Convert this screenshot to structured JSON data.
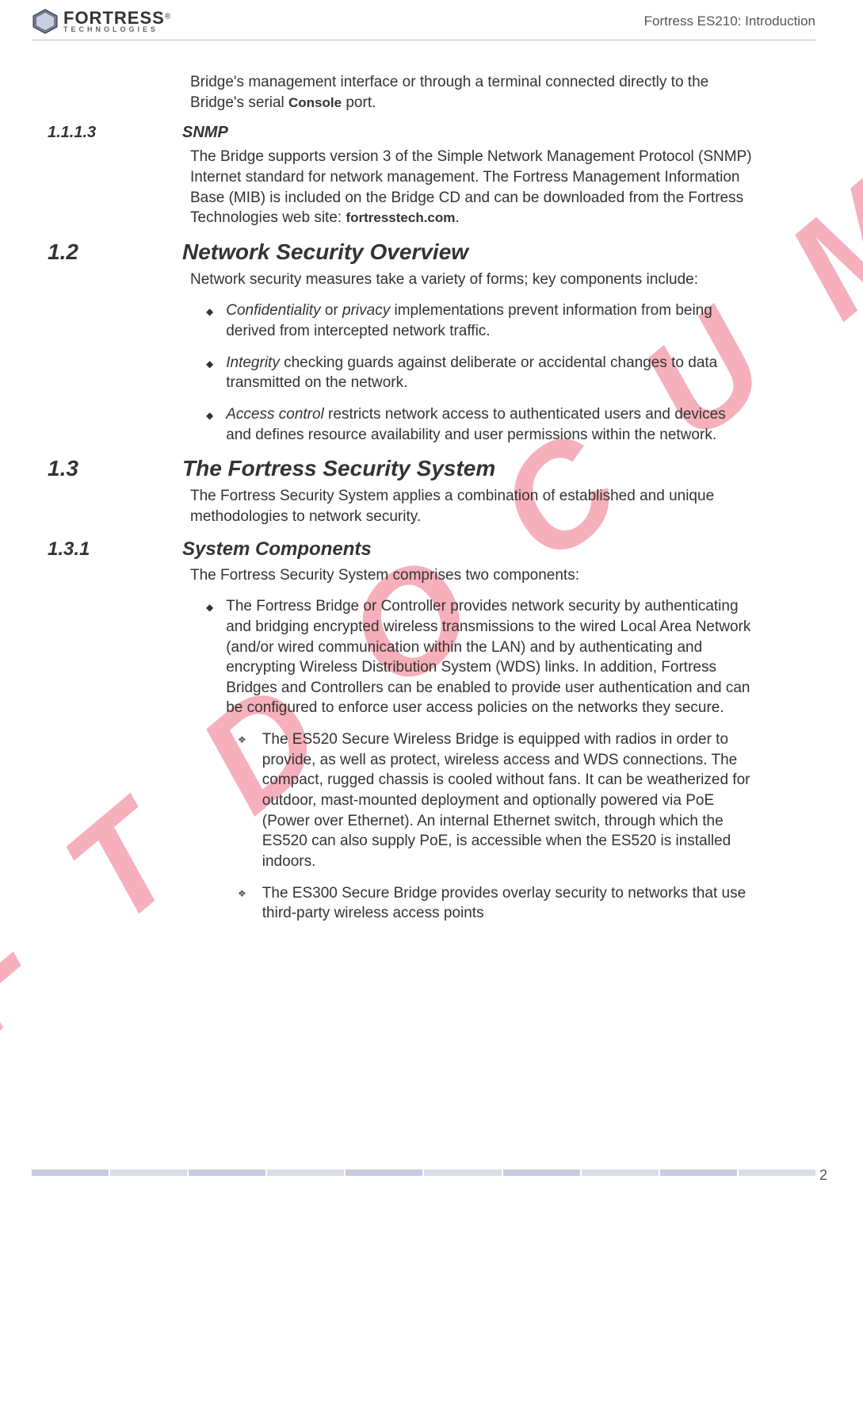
{
  "watermark": "D R A F T   D O C U M E N T",
  "header": {
    "logo_main": "FORTRESS",
    "logo_reg": "®",
    "logo_sub": "TECHNOLOGIES",
    "title": "Fortress ES210: Introduction"
  },
  "intro_fragment": "Bridge's management interface or through a terminal connected directly to the Bridge's serial Console port.",
  "sec_1113": {
    "num": "1.1.1.3",
    "title": "SNMP",
    "body": "The Bridge supports version 3 of the Simple Network Management Protocol (SNMP) Internet standard for network management. The Fortress Management Information Base (MIB) is included on the Bridge CD and can be downloaded from the Fortress Technologies web site: fortresstech.com."
  },
  "sec_12": {
    "num": "1.2",
    "title": "Network Security Overview",
    "intro": "Network security measures take a variety of forms; key components include:",
    "bullets": [
      {
        "em": "Confidentiality",
        "mid": " or ",
        "em2": "privacy",
        "rest": " implementations prevent information from being derived from intercepted network traffic."
      },
      {
        "em": "Integrity",
        "rest": " checking guards against deliberate or accidental changes to data transmitted on the network."
      },
      {
        "em": "Access control",
        "rest": " restricts network access to authenticated users and devices and defines resource availability and user permissions within the network."
      }
    ]
  },
  "sec_13": {
    "num": "1.3",
    "title": "The Fortress Security System",
    "body": "The Fortress Security System applies a combination of established and unique methodologies to network security."
  },
  "sec_131": {
    "num": "1.3.1",
    "title": "System Components",
    "intro": "The Fortress Security System comprises two components:",
    "bullet1": "The Fortress Bridge or Controller provides network security by authenticating and bridging encrypted wireless transmissions to the wired Local Area Network (and/or wired communication within the LAN) and by authenticating and encrypting Wireless Distribution System (WDS) links. In addition, Fortress Bridges and Controllers can be enabled to provide user authentication and can be configured to enforce user access policies on the networks they secure.",
    "sub1": "The ES520 Secure Wireless Bridge is equipped with radios in order to provide, as well as protect, wireless access and WDS connections. The compact, rugged chassis is cooled without fans. It can be weatherized for outdoor, mast-mounted deployment and optionally powered via PoE (Power over Ethernet). An internal Ethernet switch, through which the ES520 can also supply PoE, is accessible when the ES520 is installed indoors.",
    "sub2": "The ES300 Secure Bridge provides overlay security to networks that use third-party wireless access points"
  },
  "page_number": "2"
}
